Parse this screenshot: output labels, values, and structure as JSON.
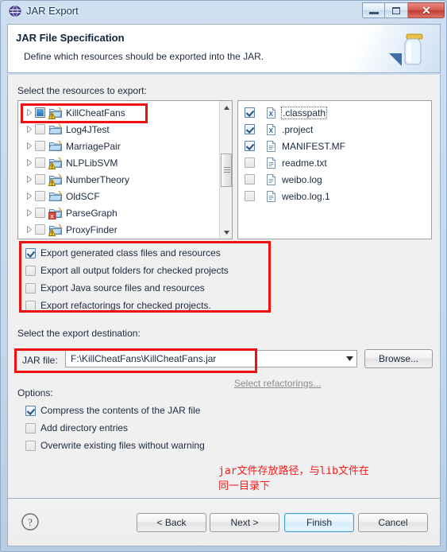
{
  "window": {
    "title": "JAR Export",
    "icon": "eclipse-globe-icon",
    "controls": {
      "minimize": "minimize-icon",
      "maximize": "maximize-icon",
      "close": "✕"
    }
  },
  "banner": {
    "title": "JAR File Specification",
    "subtitle": "Define which resources should be exported into the JAR.",
    "icon": "jar-jar-icon"
  },
  "resources": {
    "label": "Select the resources to export:",
    "tree": [
      {
        "name": "KillCheatFans",
        "state": "partial",
        "icon": "java-project-warning-icon",
        "selected": true
      },
      {
        "name": "Log4JTest",
        "state": "unchecked",
        "icon": "java-project-icon",
        "selected": false
      },
      {
        "name": "MarriagePair",
        "state": "unchecked",
        "icon": "java-project-icon",
        "selected": false
      },
      {
        "name": "NLPLibSVM",
        "state": "unchecked",
        "icon": "java-project-warning-icon",
        "selected": false
      },
      {
        "name": "NumberTheory",
        "state": "unchecked",
        "icon": "java-project-warning-icon",
        "selected": false
      },
      {
        "name": "OldSCF",
        "state": "unchecked",
        "icon": "java-project-icon",
        "selected": false
      },
      {
        "name": "ParseGraph",
        "state": "unchecked",
        "icon": "java-project-error-icon",
        "selected": false
      },
      {
        "name": "ProxyFinder",
        "state": "unchecked",
        "icon": "java-project-warning-icon",
        "selected": false
      }
    ],
    "files": [
      {
        "name": ".classpath",
        "state": "checked",
        "icon": "xml-file-icon",
        "focused": true
      },
      {
        "name": ".project",
        "state": "checked",
        "icon": "xml-file-icon",
        "focused": false
      },
      {
        "name": "MANIFEST.MF",
        "state": "checked",
        "icon": "text-file-icon",
        "focused": false
      },
      {
        "name": "readme.txt",
        "state": "unchecked",
        "icon": "text-file-icon",
        "focused": false
      },
      {
        "name": "weibo.log",
        "state": "unchecked",
        "icon": "text-file-icon",
        "focused": false
      },
      {
        "name": "weibo.log.1",
        "state": "unchecked",
        "icon": "text-file-icon",
        "focused": false
      }
    ]
  },
  "export_options": [
    {
      "label": "Export generated class files and resources",
      "state": "checked"
    },
    {
      "label": "Export all output folders for checked projects",
      "state": "unchecked"
    },
    {
      "label": "Export Java source files and resources",
      "state": "unchecked"
    },
    {
      "label": "Export refactorings for checked projects.",
      "state": "unchecked"
    }
  ],
  "refactorings_link": "Select refactorings...",
  "destination": {
    "label": "Select the export destination:",
    "field_label": "JAR file:",
    "value": "F:\\KillCheatFans\\KillCheatFans.jar",
    "browse_label": "Browse..."
  },
  "options": {
    "label": "Options:",
    "items": [
      {
        "label": "Compress the contents of the JAR file",
        "state": "checked"
      },
      {
        "label": "Add directory entries",
        "state": "unchecked"
      },
      {
        "label": "Overwrite existing files without warning",
        "state": "unchecked"
      }
    ]
  },
  "annotation": {
    "text": "jar文件存放路径，与lib文件在\n同一目录下",
    "color": "#ff1616"
  },
  "footer": {
    "help": "?",
    "back": "< Back",
    "next": "Next >",
    "finish": "Finish",
    "cancel": "Cancel"
  },
  "accent": {
    "highlight": "#ee1111",
    "default_button": "#3c9cd4"
  }
}
